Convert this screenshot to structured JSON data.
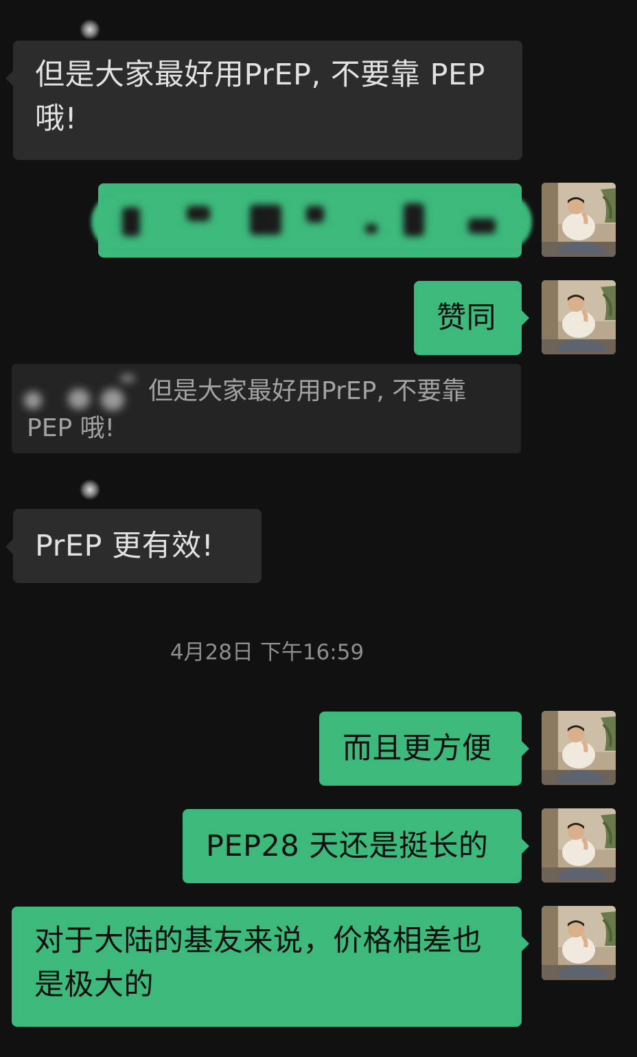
{
  "chat": {
    "messages": [
      {
        "side": "in",
        "text_line1": "但是大家最好用PrEP, 不要靠 PEP",
        "text_line2": "哦!"
      },
      {
        "side": "out",
        "text": "",
        "blurred": true
      },
      {
        "side": "out",
        "text": "赞同"
      },
      {
        "side": "in",
        "quote_line1": "但是大家最好用PrEP, 不要靠",
        "quote_line2": "PEP 哦!"
      },
      {
        "side": "in",
        "text": "PrEP 更有效!"
      },
      {
        "side": "out",
        "text": "而且更方便"
      },
      {
        "side": "out",
        "text": "PEP28 天还是挺长的"
      },
      {
        "side": "out",
        "text_line1": "对于大陆的基友来说，价格相差也",
        "text_line2": "是极大的"
      }
    ],
    "timestamp": "4月28日 下午16:59"
  },
  "colors": {
    "background": "#111111",
    "incoming_bubble": "#2c2c2c",
    "outgoing_bubble": "#3db97c",
    "quote_bubble": "#242424",
    "timestamp_text": "#8e8e8e"
  },
  "icons": {
    "avatar": "user-avatar-photo",
    "sender_avatar_blurred": "blurred-avatar-dot"
  }
}
